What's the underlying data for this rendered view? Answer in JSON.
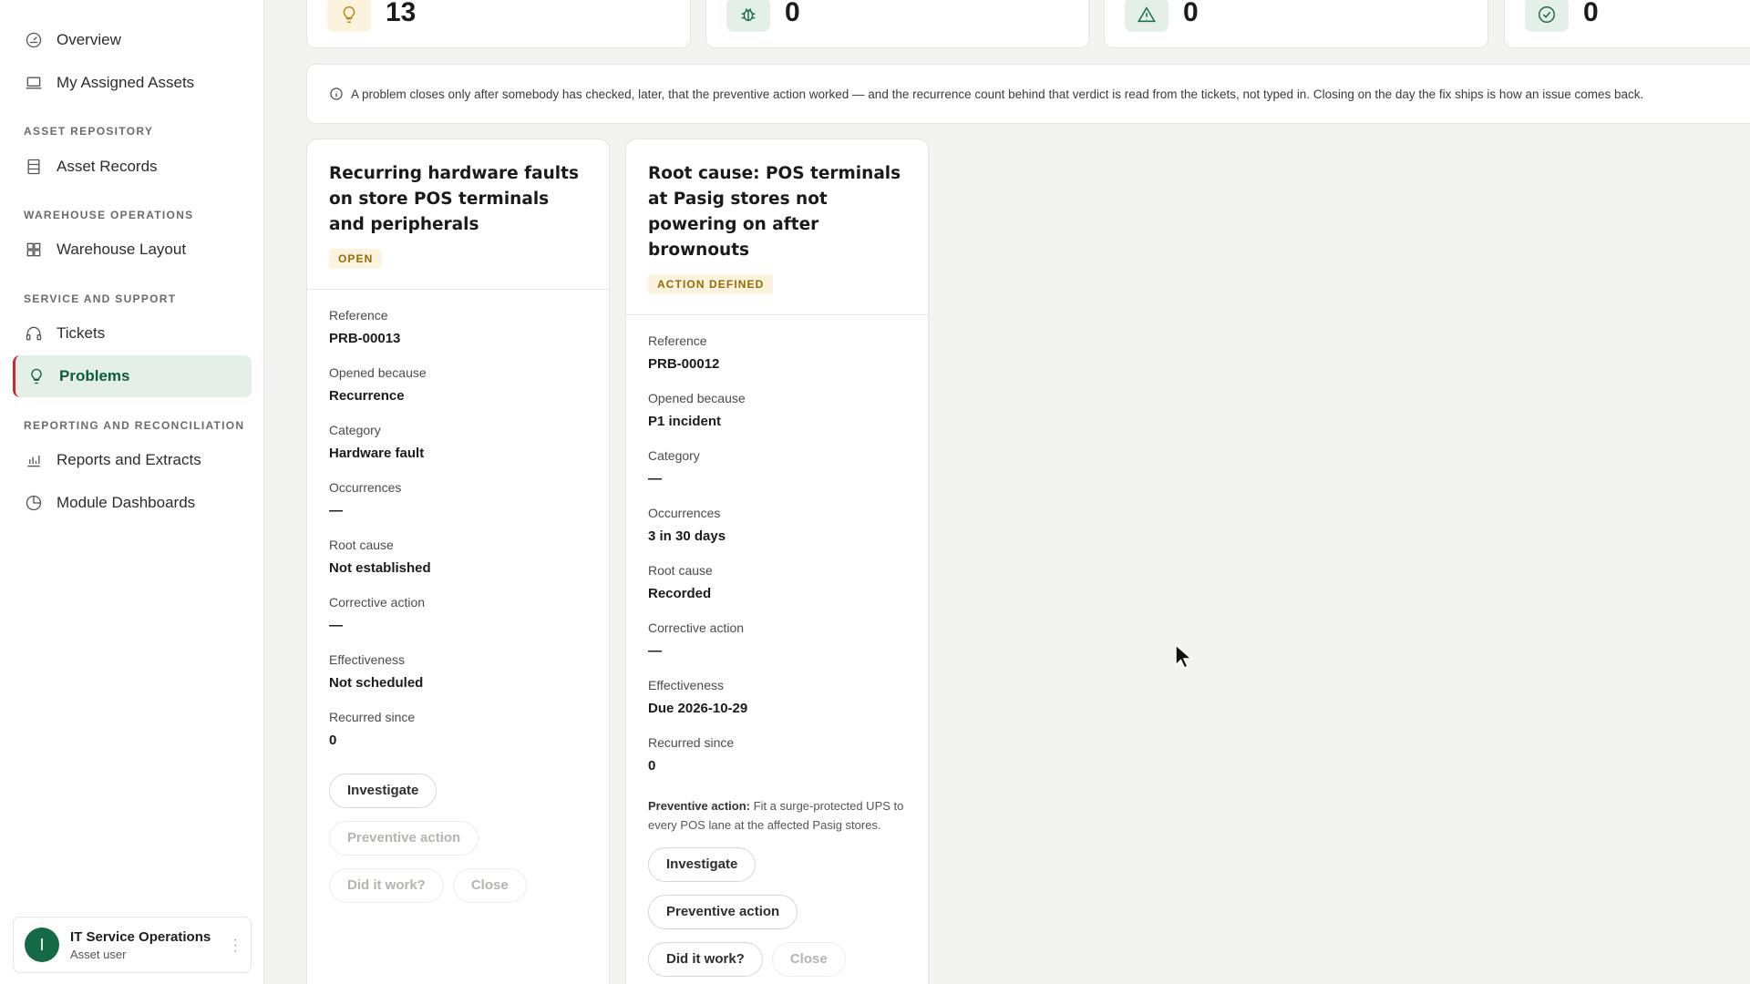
{
  "sidebar": {
    "items": [
      {
        "label": "Overview",
        "icon": "gauge-icon"
      },
      {
        "label": "My Assigned Assets",
        "icon": "laptop-icon"
      },
      {
        "label": "Asset Records",
        "icon": "records-icon"
      },
      {
        "label": "Warehouse Layout",
        "icon": "grid-icon"
      },
      {
        "label": "Tickets",
        "icon": "headset-icon"
      },
      {
        "label": "Problems",
        "icon": "lightbulb-icon"
      },
      {
        "label": "Reports and Extracts",
        "icon": "bar-chart-icon"
      },
      {
        "label": "Module Dashboards",
        "icon": "pie-chart-icon"
      }
    ],
    "sections": {
      "asset_repository": "ASSET REPOSITORY",
      "warehouse_operations": "WAREHOUSE OPERATIONS",
      "service_support": "SERVICE AND SUPPORT",
      "reporting": "REPORTING AND RECONCILIATION"
    },
    "active": "Problems",
    "user": {
      "initial": "I",
      "name": "IT Service Operations",
      "role": "Asset user"
    }
  },
  "stats": [
    {
      "value": "13",
      "icon": "lightbulb-icon",
      "bg": "#fbf3de",
      "color": "#b8860b"
    },
    {
      "value": "0",
      "icon": "bug-icon",
      "bg": "#e4efe8",
      "color": "#156a46"
    },
    {
      "value": "0",
      "icon": "warning-icon",
      "bg": "#e4efe8",
      "color": "#156a46"
    },
    {
      "value": "0",
      "icon": "check-circle-icon",
      "bg": "#e4efe8",
      "color": "#156a46"
    }
  ],
  "banner": {
    "text": "A problem closes only after somebody has checked, later, that the preventive action worked — and the recurrence count behind that verdict is read from the tickets, not typed in. Closing on the day the fix ships is how an issue comes back."
  },
  "labels": {
    "reference": "Reference",
    "opened_because": "Opened because",
    "category": "Category",
    "occurrences": "Occurrences",
    "root_cause": "Root cause",
    "corrective_action": "Corrective action",
    "effectiveness": "Effectiveness",
    "recurred_since": "Recurred since",
    "preventive_prefix": "Preventive action:"
  },
  "buttons": {
    "investigate": "Investigate",
    "preventive": "Preventive action",
    "did_it_work": "Did it work?",
    "close": "Close"
  },
  "problems": [
    {
      "title": "Recurring hardware faults on store POS terminals and peripherals",
      "status": "OPEN",
      "reference": "PRB-00013",
      "opened_because": "Recurrence",
      "category": "Hardware fault",
      "occurrences": "—",
      "root_cause": "Not established",
      "corrective_action": "—",
      "effectiveness": "Not scheduled",
      "recurred_since": "0"
    },
    {
      "title": "Root cause: POS terminals at Pasig stores not powering on after brownouts",
      "status": "ACTION DEFINED",
      "reference": "PRB-00012",
      "opened_because": "P1 incident",
      "category": "—",
      "occurrences": "3 in 30 days",
      "root_cause": "Recorded",
      "corrective_action": "—",
      "effectiveness": "Due 2026-10-29",
      "recurred_since": "0",
      "preventive_text": "Fit a surge-protected UPS to every POS lane at the affected Pasig stores."
    }
  ]
}
